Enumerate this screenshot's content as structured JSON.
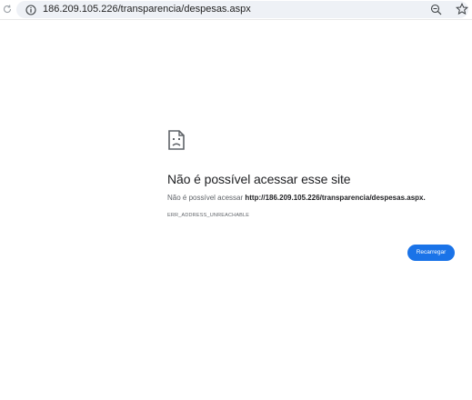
{
  "browser": {
    "url": "186.209.105.226/transparencia/despesas.aspx",
    "icons": {
      "reload": "reload-icon",
      "site_info": "info-icon",
      "zoom": "zoom-icon",
      "bookmark": "star-icon"
    }
  },
  "error_page": {
    "icon": "sad-page-icon",
    "title": "Não é possível acessar esse site",
    "description_prefix": "Não é possível acessar ",
    "description_url": "http://186.209.105.226/transparencia/despesas.aspx",
    "description_suffix": ".",
    "error_code": "ERR_ADDRESS_UNREACHABLE",
    "reload_label": "Recarregar"
  },
  "colors": {
    "accent": "#1a73e8",
    "text_primary": "#202124",
    "text_secondary": "#5f6368",
    "omnibox_bg": "#eef1f6"
  }
}
